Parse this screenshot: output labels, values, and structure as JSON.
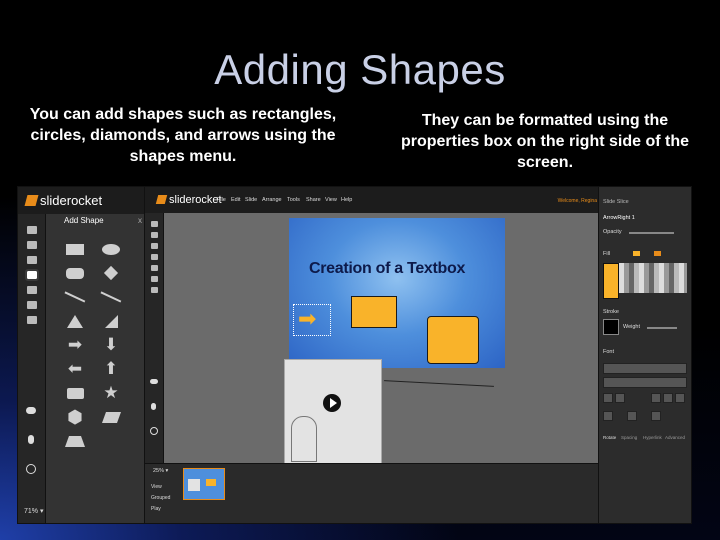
{
  "slide": {
    "title": "Adding Shapes",
    "left_caption": "You can add shapes such as rectangles, circles, diamonds, and arrows using the shapes menu.",
    "right_caption": "They can be formatted using the properties box on the right side of the screen."
  },
  "shapes_menu_screenshot": {
    "logo_text": "sliderocket",
    "panel_title": "Add Shape",
    "close_label": "x",
    "zoom_label": "71% ▾"
  },
  "editor_screenshot": {
    "logo_text": "sliderocket",
    "menu": [
      "File",
      "Edit",
      "Slide",
      "Arrange",
      "Tools",
      "Share",
      "View",
      "Help"
    ],
    "user_link": "Welcome, Regina",
    "slide_heading": "Creation of a Textbox",
    "zoom_label": "25% ▾",
    "view_options": [
      "View",
      "Grouped",
      "Play"
    ],
    "properties": {
      "header": "Slide Slice",
      "object_name": "ArrowRight 1",
      "opacity_label": "Opacity",
      "fill_label": "Fill",
      "stroke_label": "Stroke",
      "weight_label": "Weight",
      "font_label": "Font",
      "tabs": [
        "Rotate",
        "Spacing",
        "Hyperlink",
        "Advanced"
      ]
    },
    "colors": {
      "accent": "#e88c1a",
      "shape_fill": "#f9b32a",
      "slide_blue": "#4e8fdc"
    }
  }
}
